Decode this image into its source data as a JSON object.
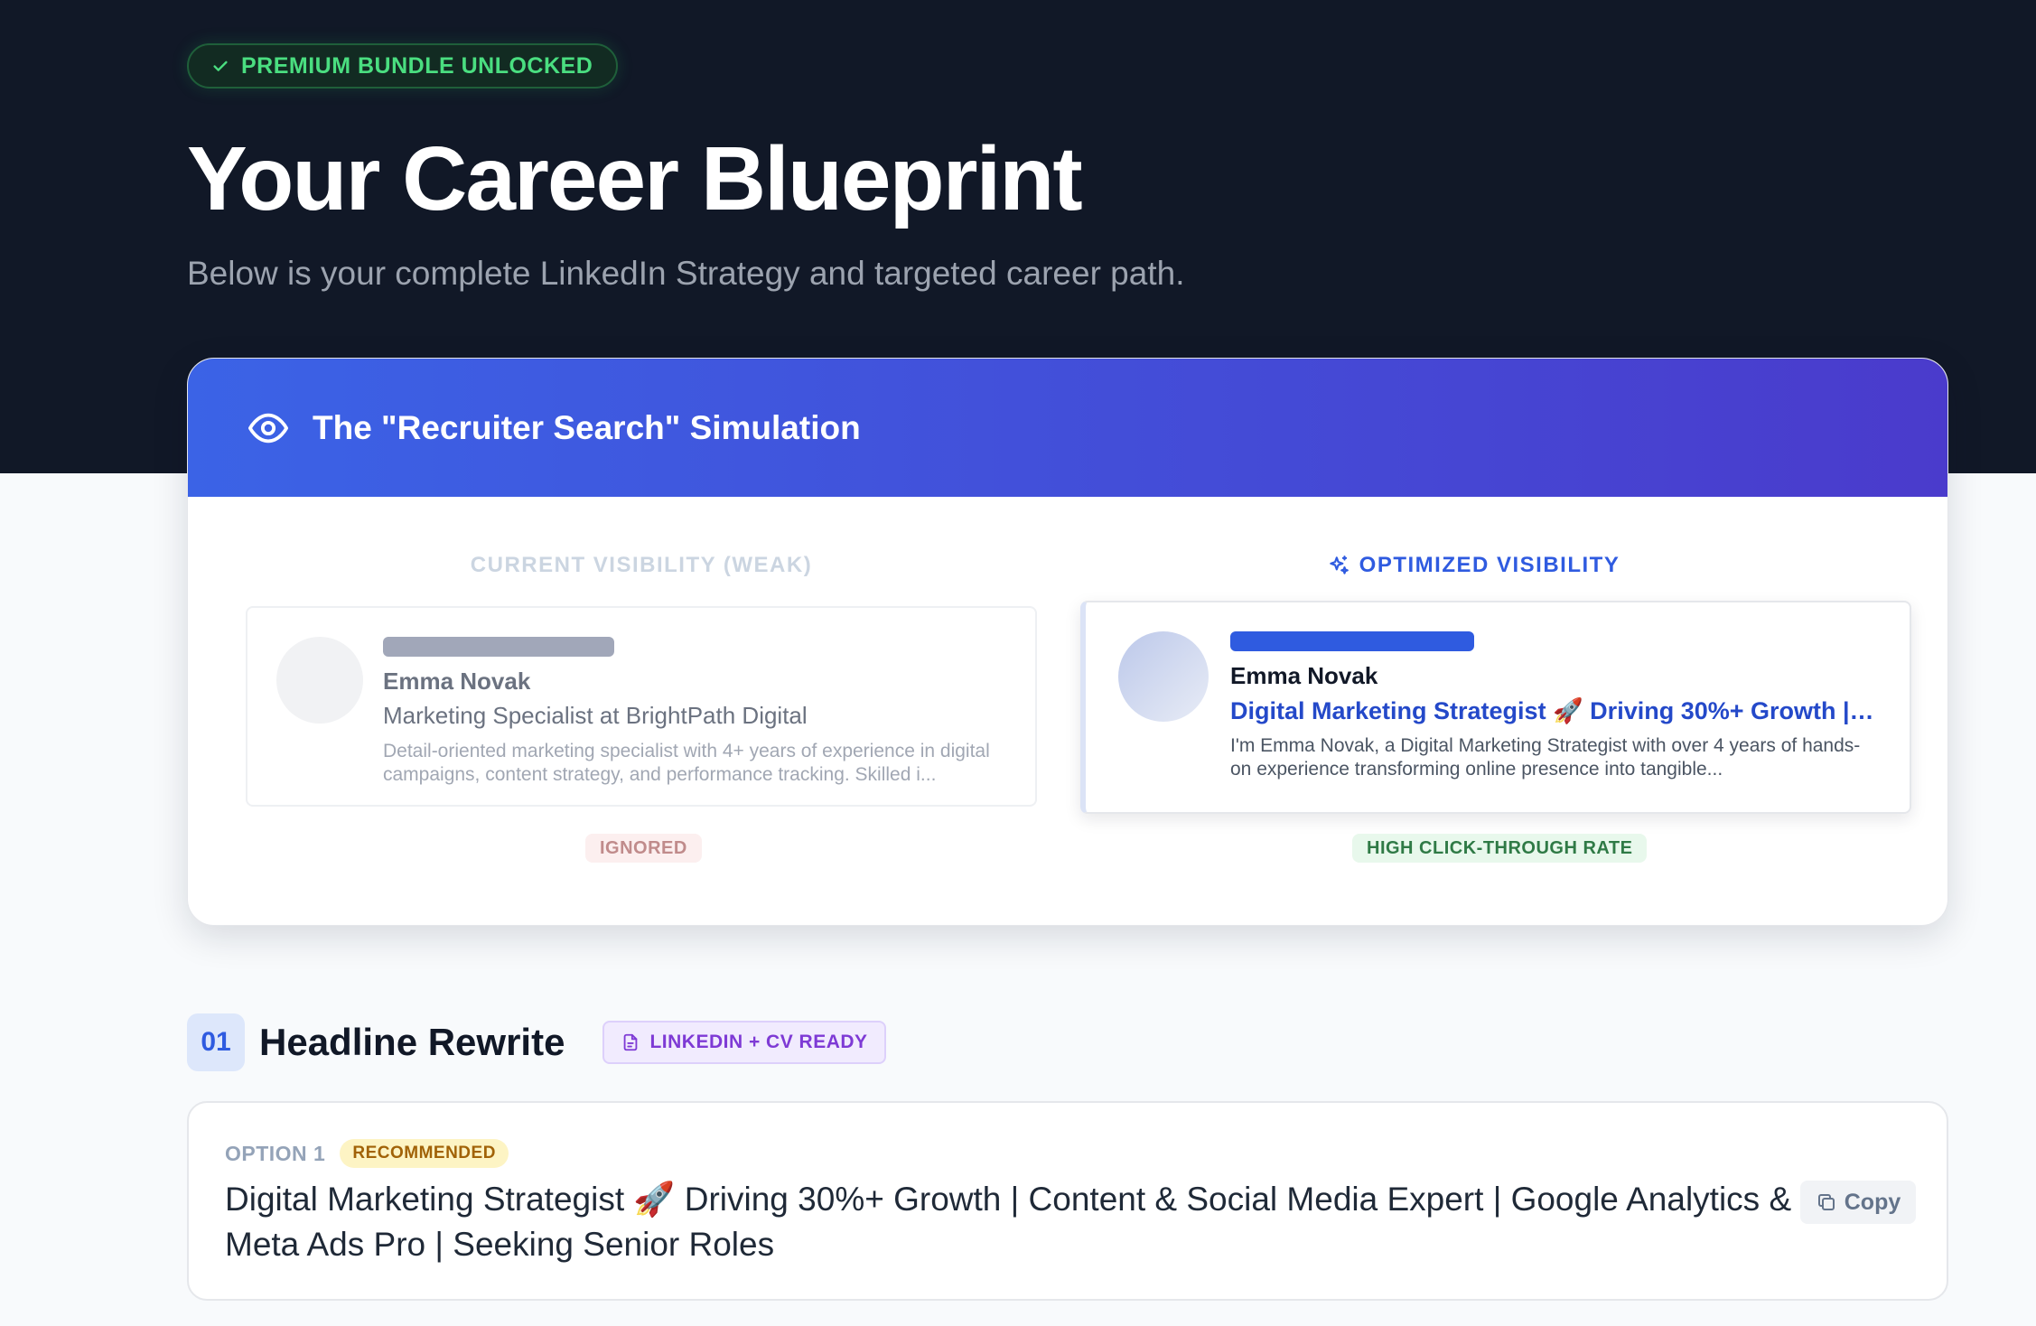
{
  "hero": {
    "badge": "PREMIUM BUNDLE UNLOCKED",
    "title": "Your Career Blueprint",
    "subtitle": "Below is your complete LinkedIn Strategy and targeted career path."
  },
  "simulation": {
    "title": "The \"Recruiter Search\" Simulation",
    "current": {
      "label": "CURRENT VISIBILITY (WEAK)",
      "name": "Emma Novak",
      "headline": "Marketing Specialist at BrightPath Digital",
      "summary": "Detail-oriented marketing specialist with 4+ years of experience in digital campaigns, content strategy, and performance tracking. Skilled i...",
      "status": "IGNORED"
    },
    "optimized": {
      "label": "OPTIMIZED VISIBILITY",
      "name": "Emma Novak",
      "headline": "Digital Marketing Strategist 🚀 Driving 30%+ Growth | C...",
      "summary": "I'm Emma Novak, a Digital Marketing Strategist with over 4 years of hands-on experience transforming online presence into tangible...",
      "status": "HIGH CLICK-THROUGH RATE"
    }
  },
  "section": {
    "number": "01",
    "title": "Headline Rewrite",
    "badge": "LINKEDIN + CV READY"
  },
  "option": {
    "label": "OPTION 1",
    "badge": "RECOMMENDED",
    "text": "Digital Marketing Strategist 🚀 Driving 30%+ Growth | Content & Social Media Expert | Google Analytics & Meta Ads Pro | Seeking Senior Roles",
    "copy_label": "Copy"
  },
  "colors": {
    "hero_bg": "#111827",
    "accent_blue": "#2f5be0",
    "header_gradient_start": "#3b63e6",
    "header_gradient_end": "#4a3bcc",
    "success_green": "#4ade80"
  }
}
